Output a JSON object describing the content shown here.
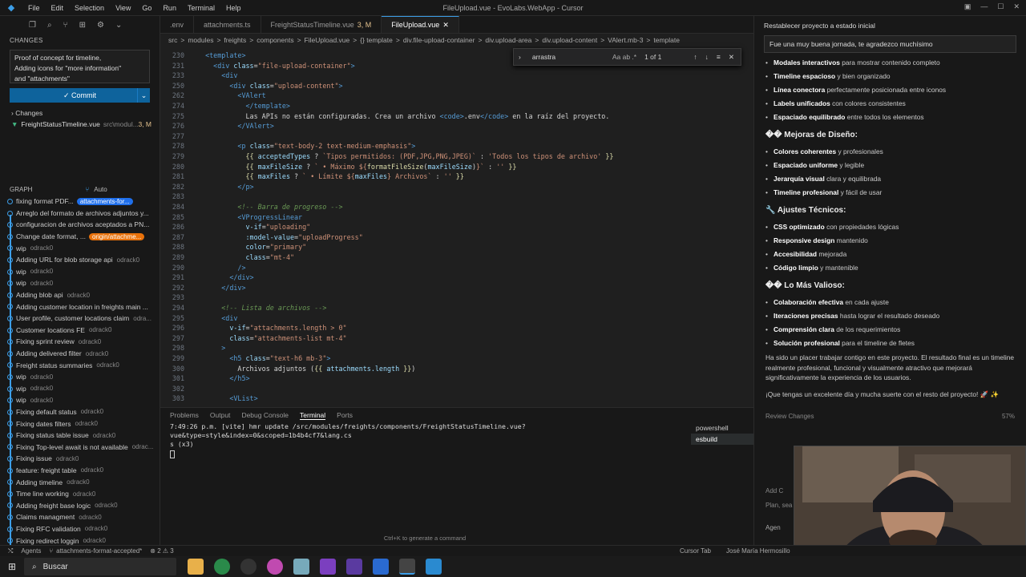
{
  "titlebar": {
    "menu": [
      "File",
      "Edit",
      "Selection",
      "View",
      "Go",
      "Run",
      "Terminal",
      "Help"
    ],
    "title": "FileUpload.vue - EvoLabs.WebApp - Cursor"
  },
  "sidebar": {
    "changes_header": "CHANGES",
    "commit_message": [
      "Proof of concept for timeline,",
      "Adding icons for \"more information\"",
      "and \"attachments\""
    ],
    "commit_button": "Commit",
    "changes_label": "Changes",
    "changed_file": {
      "name": "FreightStatusTimeline.vue",
      "path": "src\\modul...",
      "status": "3, M"
    },
    "graph_header": "GRAPH",
    "graph_auto": "Auto",
    "graph": [
      {
        "msg": "fixing format PDF...",
        "author": "",
        "tag": "attachments-for...",
        "tagColor": "#1f6feb"
      },
      {
        "msg": "Arreglo del formato de archivos adjuntos y...",
        "author": ""
      },
      {
        "msg": "configuracion de archivos aceptados a PN...",
        "author": ""
      },
      {
        "msg": "Change date format, ...",
        "author": "",
        "tag": "origin/attachme...",
        "tagColor": "#e8710a"
      },
      {
        "msg": "wip",
        "author": "odrack0"
      },
      {
        "msg": "Adding URL for blob storage api",
        "author": "odrack0"
      },
      {
        "msg": "wip",
        "author": "odrack0"
      },
      {
        "msg": "wip",
        "author": "odrack0"
      },
      {
        "msg": "Adding blob api",
        "author": "odrack0"
      },
      {
        "msg": "Adding customer location in freights main ...",
        "author": ""
      },
      {
        "msg": "User profile, customer locations claim",
        "author": "odra..."
      },
      {
        "msg": "Customer locations FE",
        "author": "odrack0"
      },
      {
        "msg": "Fixing sprint review",
        "author": "odrack0"
      },
      {
        "msg": "Adding delivered filter",
        "author": "odrack0"
      },
      {
        "msg": "Freight status summaries",
        "author": "odrack0"
      },
      {
        "msg": "wip",
        "author": "odrack0"
      },
      {
        "msg": "wip",
        "author": "odrack0"
      },
      {
        "msg": "wip",
        "author": "odrack0"
      },
      {
        "msg": "Fixing default status",
        "author": "odrack0"
      },
      {
        "msg": "Fixing dates filters",
        "author": "odrack0"
      },
      {
        "msg": "Fixing status table issue",
        "author": "odrack0"
      },
      {
        "msg": "Fixing Top-level await is not available",
        "author": "odrac..."
      },
      {
        "msg": "Fixing issue",
        "author": "odrack0"
      },
      {
        "msg": "feature: freight table",
        "author": "odrack0"
      },
      {
        "msg": "Adding timeline",
        "author": "odrack0"
      },
      {
        "msg": "Time line working",
        "author": "odrack0"
      },
      {
        "msg": "Adding freight base logic",
        "author": "odrack0"
      },
      {
        "msg": "Claims managment",
        "author": "odrack0"
      },
      {
        "msg": "Fixing RFC validation",
        "author": "odrack0"
      },
      {
        "msg": "Fixing redirect loggin",
        "author": "odrack0"
      }
    ]
  },
  "editor": {
    "tabs": [
      {
        "label": ".env",
        "active": false
      },
      {
        "label": "attachments.ts",
        "active": false
      },
      {
        "label": "FreightStatusTimeline.vue",
        "mod": "3, M",
        "active": false
      },
      {
        "label": "FileUpload.vue",
        "active": true
      }
    ],
    "breadcrumb": [
      "src",
      ">",
      "modules",
      ">",
      "freights",
      ">",
      "components",
      ">",
      "FileUpload.vue",
      ">",
      "{} template",
      ">",
      "div.file-upload-container",
      ">",
      "div.upload-area",
      ">",
      "div.upload-content",
      ">",
      "VAlert.mb-3",
      ">",
      "template"
    ],
    "find": {
      "query": "arrastra",
      "opts": "Aa ab .*",
      "result": "1 of 1"
    },
    "lines": [
      {
        "n": "230",
        "h": "  <span class=t>&lt;template&gt;</span>"
      },
      {
        "n": "231",
        "h": "    <span class=t>&lt;div</span> <span class=a>class</span>=<span class=s>\"file-upload-container\"</span><span class=t>&gt;</span>"
      },
      {
        "n": "233",
        "h": "      <span class=t>&lt;div</span>"
      },
      {
        "n": "250",
        "h": "        <span class=t>&lt;div</span> <span class=a>class</span>=<span class=s>\"upload-content\"</span><span class=t>&gt;</span>"
      },
      {
        "n": "262",
        "h": "          <span class=t>&lt;VAlert</span>"
      },
      {
        "n": "274",
        "h": "            <span class=t>&lt;/template&gt;</span>"
      },
      {
        "n": "275",
        "h": "            Las APIs no están configuradas. Crea un archivo <span class=t>&lt;code&gt;</span>.env<span class=t>&lt;/code&gt;</span> en la raíz del proyecto."
      },
      {
        "n": "276",
        "h": "          <span class=t>&lt;/VAlert&gt;</span>"
      },
      {
        "n": "277",
        "h": ""
      },
      {
        "n": "278",
        "h": "          <span class=t>&lt;p</span> <span class=a>class</span>=<span class=s>\"text-body-2 text-medium-emphasis\"</span><span class=t>&gt;</span>"
      },
      {
        "n": "279",
        "h": "            <span class=y>{{</span> <span class=a>acceptedTypes</span> ? <span class=s>`Tipos permitidos: (PDF,JPG,PNG,JPEG)`</span> : <span class=s>'Todos los tipos de archivo'</span> <span class=y>}}</span>"
      },
      {
        "n": "280",
        "h": "            <span class=y>{{</span> <span class=a>maxFileSize</span> ? <span class=s>` • Máximo ${</span><span class=y>formatFileSize</span>(<span class=a>maxFileSize</span>)<span class=s>}`</span> : <span class=s>''</span> <span class=y>}}</span>"
      },
      {
        "n": "281",
        "h": "            <span class=y>{{</span> <span class=a>maxFiles</span> ? <span class=s>` • Límite ${</span><span class=a>maxFiles</span><span class=s>} Archivos`</span> : <span class=s>''</span> <span class=y>}}</span>"
      },
      {
        "n": "282",
        "h": "          <span class=t>&lt;/p&gt;</span>"
      },
      {
        "n": "283",
        "h": ""
      },
      {
        "n": "284",
        "h": "          <span class=c>&lt;!-- Barra de progreso --&gt;</span>"
      },
      {
        "n": "285",
        "h": "          <span class=t>&lt;VProgressLinear</span>"
      },
      {
        "n": "286",
        "h": "            <span class=a>v-if</span>=<span class=s>\"uploading\"</span>"
      },
      {
        "n": "287",
        "h": "            <span class=a>:model-value</span>=<span class=s>\"uploadProgress\"</span>"
      },
      {
        "n": "288",
        "h": "            <span class=a>color</span>=<span class=s>\"primary\"</span>"
      },
      {
        "n": "289",
        "h": "            <span class=a>class</span>=<span class=s>\"mt-4\"</span>"
      },
      {
        "n": "290",
        "h": "          <span class=t>/&gt;</span>"
      },
      {
        "n": "291",
        "h": "        <span class=t>&lt;/div&gt;</span>"
      },
      {
        "n": "292",
        "h": "      <span class=t>&lt;/div&gt;</span>"
      },
      {
        "n": "293",
        "h": ""
      },
      {
        "n": "294",
        "h": "      <span class=c>&lt;!-- Lista de archivos --&gt;</span>"
      },
      {
        "n": "295",
        "h": "      <span class=t>&lt;div</span>"
      },
      {
        "n": "296",
        "h": "        <span class=a>v-if</span>=<span class=s>\"attachments.length &gt; 0\"</span>"
      },
      {
        "n": "297",
        "h": "        <span class=a>class</span>=<span class=s>\"attachments-list mt-4\"</span>"
      },
      {
        "n": "298",
        "h": "      <span class=t>&gt;</span>"
      },
      {
        "n": "299",
        "h": "        <span class=t>&lt;h5</span> <span class=a>class</span>=<span class=s>\"text-h6 mb-3\"</span><span class=t>&gt;</span>"
      },
      {
        "n": "300",
        "h": "          Archivos adjuntos (<span class=y>{{</span> <span class=a>attachments.length</span> <span class=y>}}</span>)"
      },
      {
        "n": "301",
        "h": "        <span class=t>&lt;/h5&gt;</span>"
      },
      {
        "n": "302",
        "h": ""
      },
      {
        "n": "303",
        "h": "        <span class=t>&lt;VList&gt;</span>"
      }
    ]
  },
  "panel": {
    "tabs": [
      "Problems",
      "Output",
      "Debug Console",
      "Terminal",
      "Ports"
    ],
    "terminal_lines": [
      "7:49:26 p.m. [vite] hmr update /src/modules/freights/components/FreightStatusTimeline.vue?vue&type=style&index=0&scoped=1b4b4cf7&lang.cs",
      "s (x3)"
    ],
    "terminals": [
      "powershell",
      "esbuild"
    ],
    "hint": "Ctrl+K to generate a command"
  },
  "chat": {
    "title": "Restablecer proyecto a estado inicial",
    "input": "Fue una muy buena jornada, te agradezco muchísimo",
    "group1": [
      [
        "Modales interactivos",
        "para mostrar contenido completo"
      ],
      [
        "Timeline espacioso",
        "y bien organizado"
      ],
      [
        "Línea conectora",
        "perfectamente posicionada entre iconos"
      ],
      [
        "Labels unificados",
        "con colores consistentes"
      ],
      [
        "Espaciado equilibrado",
        "entre todos los elementos"
      ]
    ],
    "h_design": "�� Mejoras de Diseño:",
    "group2": [
      [
        "Colores coherentes",
        "y profesionales"
      ],
      [
        "Espaciado uniforme",
        "y legible"
      ],
      [
        "Jerarquía visual",
        "clara y equilibrada"
      ],
      [
        "Timeline profesional",
        "y fácil de usar"
      ]
    ],
    "h_tech": "🔧 Ajustes Técnicos:",
    "group3": [
      [
        "CSS optimizado",
        "con propiedades lógicas"
      ],
      [
        "Responsive design",
        "mantenido"
      ],
      [
        "Accesibilidad",
        "mejorada"
      ],
      [
        "Código limpio",
        "y mantenible"
      ]
    ],
    "h_valuable": "�� Lo Más Valioso:",
    "group4": [
      [
        "Colaboración efectiva",
        "en cada ajuste"
      ],
      [
        "Iteraciones precisas",
        "hasta lograr el resultado deseado"
      ],
      [
        "Comprensión clara",
        "de los requerimientos"
      ],
      [
        "Solución profesional",
        "para el timeline de fletes"
      ]
    ],
    "para1": "Ha sido un placer trabajar contigo en este proyecto. El resultado final es un timeline realmente profesional, funcional y visualmente atractivo que mejorará significativamente la experiencia de los usuarios.",
    "para2": "¡Que tengas un excelente día y mucha suerte con el resto del proyecto! 🚀 ✨",
    "review": "Review Changes",
    "percent": "57%",
    "add_ctx": "Add C",
    "plan": "Plan, sea",
    "agent": "Agen"
  },
  "statusbar": {
    "agents": "Agents",
    "branch": "attachments-format-accepted*",
    "problems": "⊗ 2 ⚠ 3",
    "cursor_tab": "Cursor Tab",
    "user": "José María Hermosillo"
  },
  "taskbar": {
    "search": "Buscar"
  }
}
